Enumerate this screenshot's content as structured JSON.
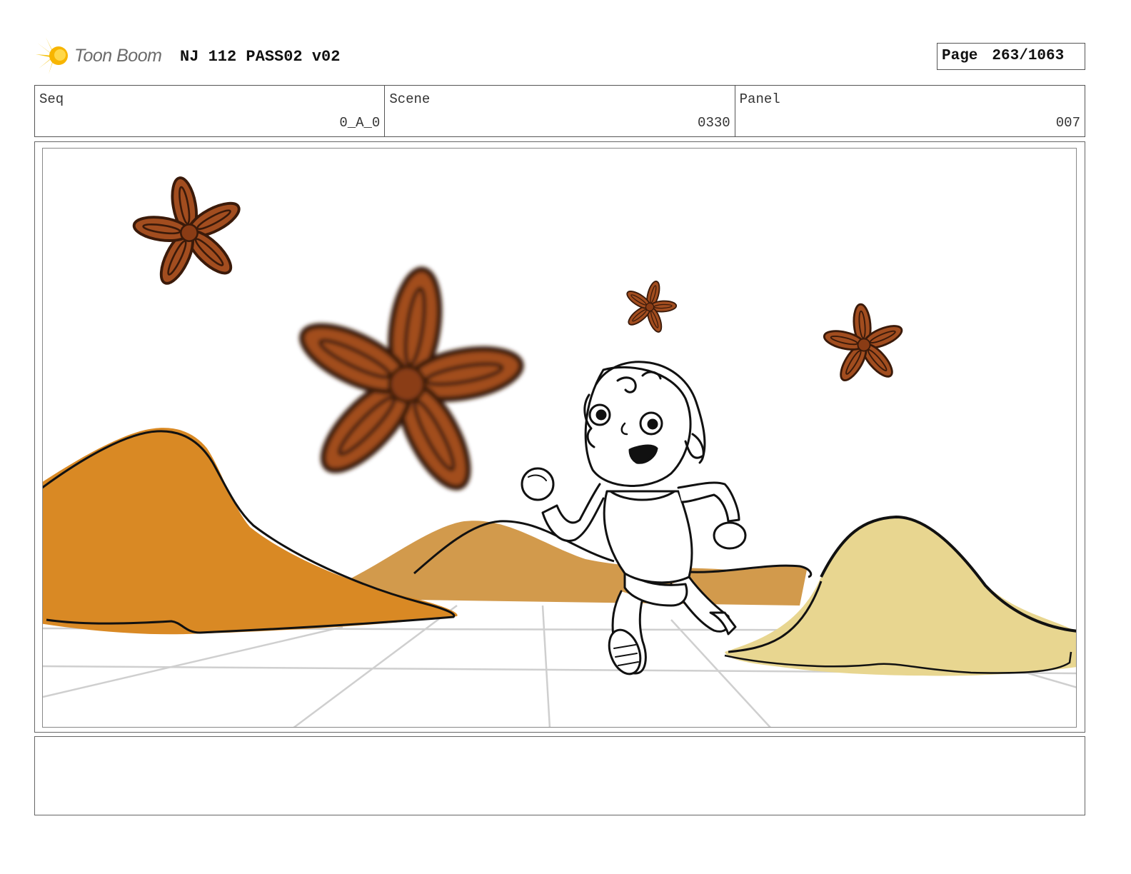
{
  "header": {
    "logo_text": "Toon Boom",
    "project_title": "NJ 112 PASS02 v02",
    "page_label": "Page",
    "page_number": "263/1063"
  },
  "info": {
    "seq_label": "Seq",
    "seq_value": "0_A_0",
    "scene_label": "Scene",
    "scene_value": "0330",
    "panel_label": "Panel",
    "panel_value": "007"
  },
  "colors": {
    "anise": "#a24d1f",
    "dune_orange": "#d98924",
    "dune_tan": "#d29a4c",
    "dune_sand": "#e8d690",
    "floor_lines": "#cfcfcf"
  },
  "notes": {
    "text": ""
  }
}
